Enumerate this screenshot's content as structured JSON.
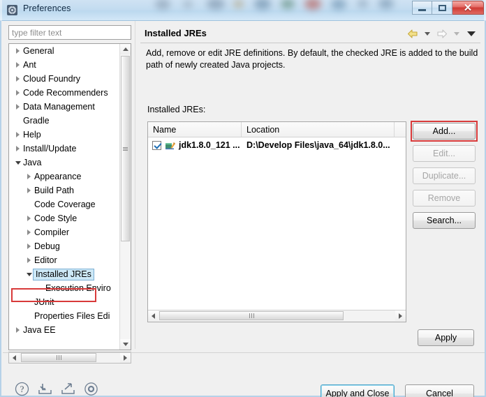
{
  "window": {
    "title": "Preferences",
    "icon": "preferences-gear-icon",
    "controls": {
      "minimize": "minimize-icon",
      "maximize": "restore-icon",
      "close": "✕"
    }
  },
  "sidebar": {
    "filter": {
      "placeholder": "type filter text",
      "value": ""
    },
    "items": [
      {
        "label": "General",
        "indent": 0,
        "twisty": "collapsed",
        "selected": false
      },
      {
        "label": "Ant",
        "indent": 0,
        "twisty": "collapsed",
        "selected": false
      },
      {
        "label": "Cloud Foundry",
        "indent": 0,
        "twisty": "collapsed",
        "selected": false
      },
      {
        "label": "Code Recommenders",
        "indent": 0,
        "twisty": "collapsed",
        "selected": false
      },
      {
        "label": "Data Management",
        "indent": 0,
        "twisty": "collapsed",
        "selected": false
      },
      {
        "label": "Gradle",
        "indent": 0,
        "twisty": "none",
        "selected": false
      },
      {
        "label": "Help",
        "indent": 0,
        "twisty": "collapsed",
        "selected": false
      },
      {
        "label": "Install/Update",
        "indent": 0,
        "twisty": "collapsed",
        "selected": false
      },
      {
        "label": "Java",
        "indent": 0,
        "twisty": "expanded",
        "selected": false
      },
      {
        "label": "Appearance",
        "indent": 1,
        "twisty": "collapsed",
        "selected": false
      },
      {
        "label": "Build Path",
        "indent": 1,
        "twisty": "collapsed",
        "selected": false
      },
      {
        "label": "Code Coverage",
        "indent": 1,
        "twisty": "none",
        "selected": false
      },
      {
        "label": "Code Style",
        "indent": 1,
        "twisty": "collapsed",
        "selected": false
      },
      {
        "label": "Compiler",
        "indent": 1,
        "twisty": "collapsed",
        "selected": false
      },
      {
        "label": "Debug",
        "indent": 1,
        "twisty": "collapsed",
        "selected": false
      },
      {
        "label": "Editor",
        "indent": 1,
        "twisty": "collapsed",
        "selected": false
      },
      {
        "label": "Installed JREs",
        "indent": 1,
        "twisty": "expanded",
        "selected": true
      },
      {
        "label": "Execution Enviro",
        "indent": 2,
        "twisty": "none",
        "selected": false
      },
      {
        "label": "JUnit",
        "indent": 1,
        "twisty": "none",
        "selected": false
      },
      {
        "label": "Properties Files Edi",
        "indent": 1,
        "twisty": "none",
        "selected": false
      },
      {
        "label": "Java EE",
        "indent": 0,
        "twisty": "collapsed",
        "selected": false
      }
    ]
  },
  "page": {
    "title": "Installed JREs",
    "description": "Add, remove or edit JRE definitions. By default, the checked JRE is added to the build path of newly created Java projects.",
    "nav": {
      "back_icon": "back-arrow-icon",
      "back_dropdown_icon": "chevron-down-icon",
      "forward_icon": "forward-arrow-icon",
      "forward_dropdown_icon": "chevron-down-icon",
      "menu_icon": "view-menu-icon"
    }
  },
  "table": {
    "label": "Installed JREs:",
    "columns": [
      "Name",
      "Location"
    ],
    "rows": [
      {
        "checked": true,
        "icon": "jre-library-icon",
        "name": "jdk1.8.0_121 ...",
        "location": "D:\\Develop Files\\java_64\\jdk1.8.0..."
      }
    ]
  },
  "buttons": {
    "add": {
      "label": "Add...",
      "enabled": true,
      "highlighted": true
    },
    "edit": {
      "label": "Edit...",
      "enabled": false
    },
    "duplicate": {
      "label": "Duplicate...",
      "enabled": false
    },
    "remove": {
      "label": "Remove",
      "enabled": false
    },
    "search": {
      "label": "Search...",
      "enabled": true
    },
    "apply": {
      "label": "Apply",
      "enabled": true
    },
    "apply_and_close": {
      "label": "Apply and Close",
      "enabled": true,
      "default": true
    },
    "cancel": {
      "label": "Cancel",
      "enabled": true
    }
  },
  "footer_icons": [
    {
      "name": "help-icon"
    },
    {
      "name": "import-icon"
    },
    {
      "name": "export-icon"
    },
    {
      "name": "restore-defaults-icon"
    }
  ],
  "colors": {
    "annotation": "#d83a3a",
    "selection": "#cde8f6",
    "title_bar": "#c3dcf0",
    "close_button": "#cf3b34",
    "default_button_focus": "#4aa3c9"
  }
}
